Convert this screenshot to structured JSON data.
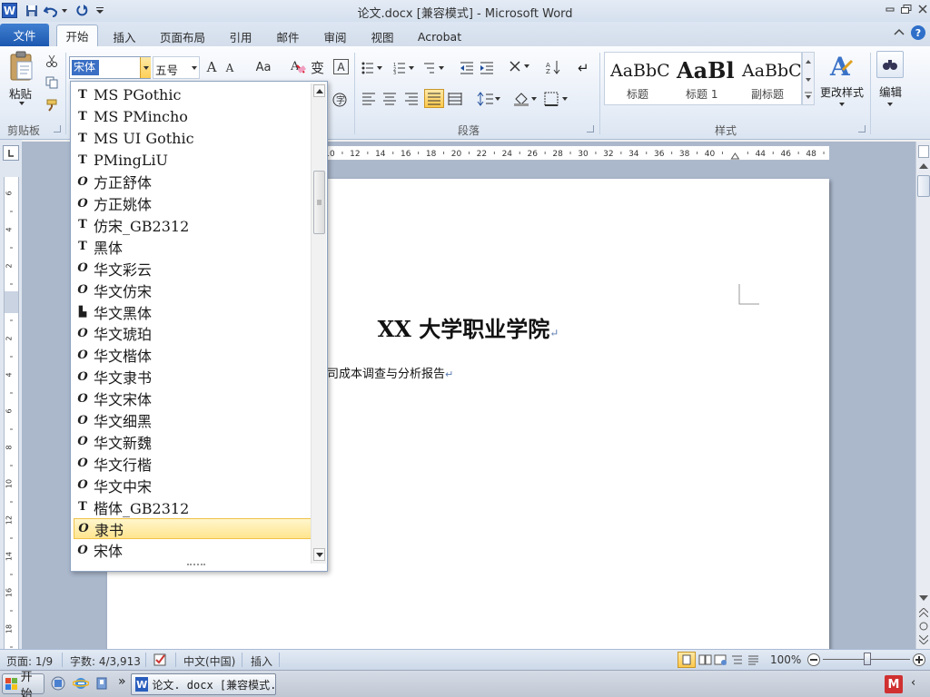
{
  "window": {
    "title": "论文.docx [兼容模式] - Microsoft Word"
  },
  "tabs": [
    "文件",
    "开始",
    "插入",
    "页面布局",
    "引用",
    "邮件",
    "审阅",
    "视图",
    "Acrobat"
  ],
  "ribbon": {
    "clipboard": {
      "paste_label": "粘贴",
      "group_label": "剪贴板"
    },
    "font": {
      "font_name_value": "宋体",
      "font_size_value": "五号",
      "grow_label": "A",
      "shrink_label": "A",
      "case_label": "Aa",
      "clear_label": "A",
      "char_border_label": "A"
    },
    "paragraph": {
      "group_label": "段落"
    },
    "styles": {
      "group_label": "样式",
      "items": [
        {
          "preview": "AaBbC",
          "label": "标题"
        },
        {
          "preview": "AaBl",
          "label": "标题 1"
        },
        {
          "preview": "AaBbC",
          "label": "副标题"
        }
      ],
      "change_styles_label": "更改样式"
    },
    "editing": {
      "label": "编辑"
    }
  },
  "font_dropdown": {
    "items": [
      {
        "name": "MS PGothic",
        "type": "truetype"
      },
      {
        "name": "MS PMincho",
        "type": "truetype"
      },
      {
        "name": "MS UI Gothic",
        "type": "truetype"
      },
      {
        "name": "PMingLiU",
        "type": "truetype"
      },
      {
        "name": "方正舒体",
        "type": "opentype"
      },
      {
        "name": "方正姚体",
        "type": "opentype"
      },
      {
        "name": "仿宋_GB2312",
        "type": "truetype"
      },
      {
        "name": "黑体",
        "type": "truetype"
      },
      {
        "name": "华文彩云",
        "type": "opentype"
      },
      {
        "name": "华文仿宋",
        "type": "opentype"
      },
      {
        "name": "华文黑体",
        "type": "printer"
      },
      {
        "name": "华文琥珀",
        "type": "opentype"
      },
      {
        "name": "华文楷体",
        "type": "opentype"
      },
      {
        "name": "华文隶书",
        "type": "opentype"
      },
      {
        "name": "华文宋体",
        "type": "opentype"
      },
      {
        "name": "华文细黑",
        "type": "opentype"
      },
      {
        "name": "华文新魏",
        "type": "opentype"
      },
      {
        "name": "华文行楷",
        "type": "opentype"
      },
      {
        "name": "华文中宋",
        "type": "opentype"
      },
      {
        "name": "楷体_GB2312",
        "type": "truetype"
      },
      {
        "name": "隶书",
        "type": "opentype",
        "highlighted": true
      },
      {
        "name": "宋体",
        "type": "opentype"
      }
    ]
  },
  "ruler_numbers": [
    "10",
    "12",
    "14",
    "16",
    "18",
    "20",
    "22",
    "24",
    "26",
    "28",
    "30",
    "32",
    "34",
    "36",
    "38",
    "40",
    "",
    "44",
    "46",
    "48"
  ],
  "vruler_numbers": [
    "6",
    "4",
    "2",
    "",
    "2",
    "4",
    "6",
    "8",
    "10",
    "12",
    "14",
    "16",
    "18"
  ],
  "document": {
    "title": "XX 大学职业学院",
    "subtitle": "司成本调查与分析报告"
  },
  "status_bar": {
    "page": "页面: 1/9",
    "words": "字数: 4/3,913",
    "language": "中文(中国)",
    "mode": "插入",
    "zoom": "100%"
  },
  "taskbar": {
    "start_label": "开始",
    "window_button": "论文. docx [兼容模式..."
  }
}
